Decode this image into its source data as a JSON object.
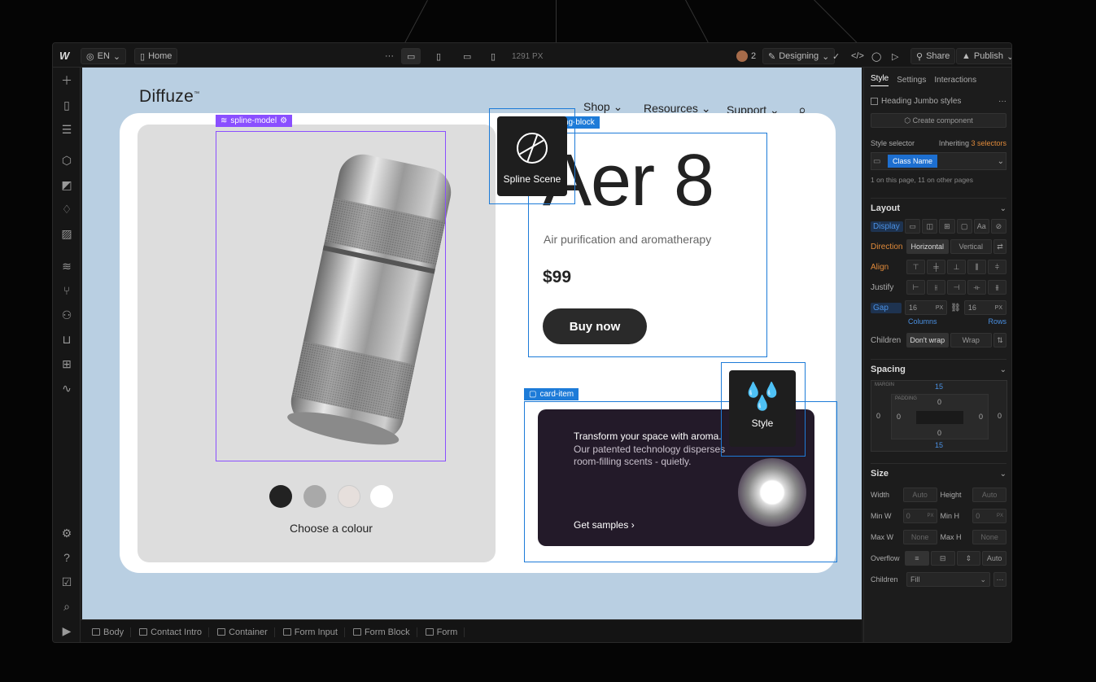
{
  "topbar": {
    "language": "EN",
    "page": "Home",
    "width_readout": "1291 PX",
    "collaborators": "2",
    "mode": "Designing",
    "share": "Share",
    "publish": "Publish"
  },
  "breadcrumb": [
    "Body",
    "Contact Intro",
    "Container",
    "Form Input",
    "Form Block",
    "Form"
  ],
  "site": {
    "logo": "Diffuze",
    "logo_tm": "™",
    "nav": [
      "Shop",
      "Resources",
      "Support"
    ],
    "product_title": "Aer 8",
    "product_subtitle": "Air purification and aromatherapy",
    "price": "$99",
    "buy_button": "Buy now",
    "colour_label": "Choose a colour",
    "swatches": [
      "#222222",
      "#a9a9a9",
      "#e6dfdc",
      "#ffffff"
    ],
    "card_title": "Transform your space with aroma.",
    "card_body": "Our patented technology disperses room-filling scents - quietly.",
    "card_link": "Get samples",
    "card_link_arrow": "›"
  },
  "selections": {
    "spline_tag": "spline-model",
    "heading_tag": "heading-block",
    "card_tag": "card-item"
  },
  "popups": {
    "spline": "Spline Scene",
    "style": "Style"
  },
  "panel": {
    "tabs": [
      "Style",
      "Settings",
      "Interactions"
    ],
    "heading_jumbo": "Heading Jumbo styles",
    "create_component": "Create component",
    "style_selector": "Style selector",
    "inheriting": "Inheriting",
    "inheriting_count": "3 selectors",
    "class_name": "Class Name",
    "page_usage": "1 on this page, 11 on other pages",
    "layout": {
      "title": "Layout",
      "display": "Display",
      "direction": "Direction",
      "horizontal": "Horizontal",
      "vertical": "Vertical",
      "align": "Align",
      "justify": "Justify",
      "gap": "Gap",
      "gap_col": "16",
      "gap_row": "16",
      "unit": "PX",
      "columns": "Columns",
      "rows": "Rows",
      "children": "Children",
      "dont_wrap": "Don't wrap",
      "wrap": "Wrap"
    },
    "spacing": {
      "title": "Spacing",
      "margin_label": "MARGIN",
      "padding_label": "PADDING",
      "margin_top": "15",
      "margin_bottom": "15",
      "margin_left": "0",
      "margin_right": "0",
      "padding_top": "0",
      "padding_bottom": "0",
      "padding_left": "0",
      "padding_right": "0"
    },
    "size": {
      "title": "Size",
      "width": "Width",
      "height": "Height",
      "auto": "Auto",
      "min_w": "Min W",
      "min_h": "Min H",
      "min_val": "0",
      "max_w": "Max W",
      "max_h": "Max H",
      "none": "None",
      "px": "PX",
      "overflow": "Overflow",
      "overflow_auto": "Auto",
      "children": "Children",
      "fill": "Fill"
    }
  }
}
